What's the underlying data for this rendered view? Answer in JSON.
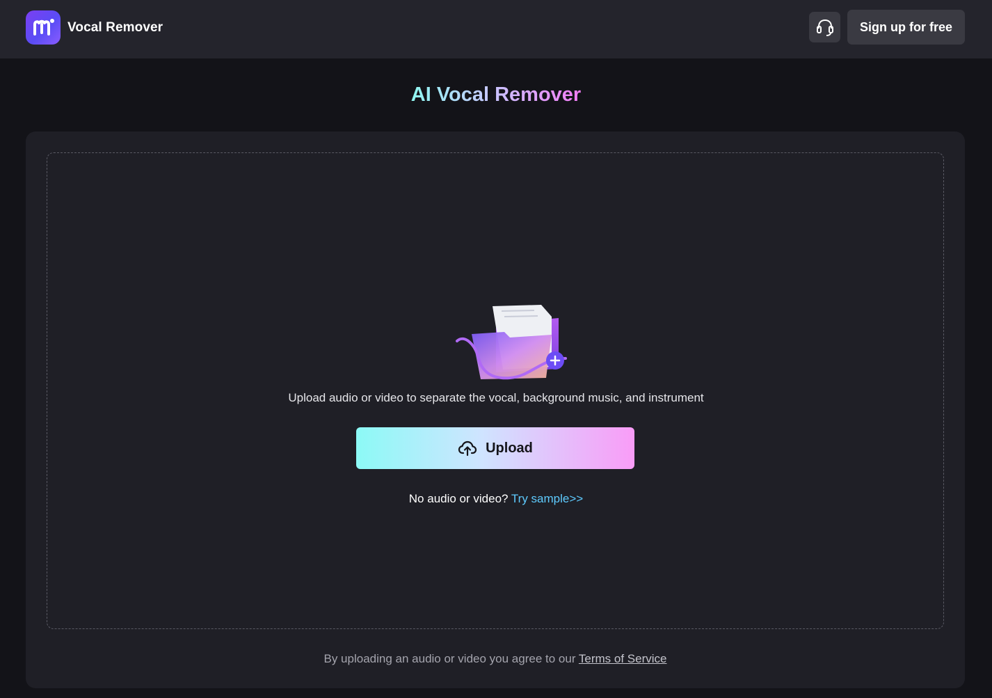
{
  "header": {
    "brand": "Vocal Remover",
    "logo_icon": "media-io-logo",
    "support_icon": "headset-icon",
    "signup_label": "Sign up for free"
  },
  "main": {
    "title": "AI Vocal Remover",
    "upload_hint": "Upload audio or video to separate the vocal, background music, and instrument",
    "upload_label": "Upload",
    "sample_prompt": "No audio or video?",
    "sample_link": "Try sample>>",
    "terms_prefix": "By uploading an audio or video you agree to our",
    "terms_link": "Terms of Service"
  },
  "colors": {
    "background": "#131318",
    "header": "#24242c",
    "card": "#1f1f26",
    "accent_cyan": "#8cfaf6",
    "accent_pink": "#f99cf7",
    "link": "#5ecbff"
  }
}
